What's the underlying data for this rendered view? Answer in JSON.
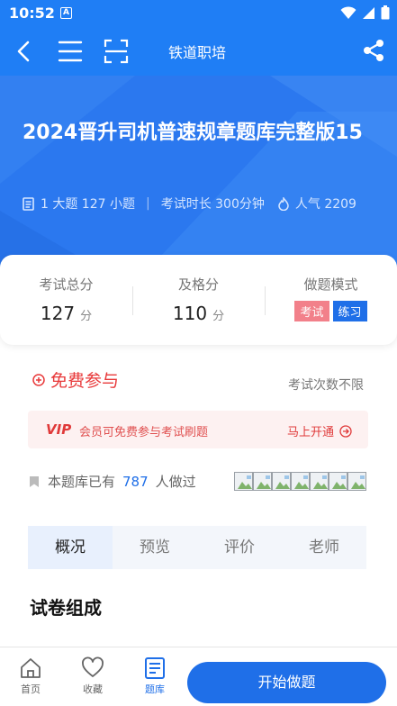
{
  "status_bar": {
    "time": "10:52",
    "a_badge": "A"
  },
  "nav": {
    "title": "铁道职培"
  },
  "hero": {
    "title": "2024晋升司机普速规章题库完整版15",
    "meta_questions": "1 大题 127 小题",
    "meta_duration": "考试时长 300分钟",
    "meta_popularity": "人气 2209"
  },
  "score_card": {
    "total_label": "考试总分",
    "total_value": "127",
    "total_unit": "分",
    "pass_label": "及格分",
    "pass_value": "110",
    "pass_unit": "分",
    "mode_label": "做题模式",
    "mode_exam": "考试",
    "mode_practice": "练习"
  },
  "free": {
    "label": "免费参与",
    "attempts": "考试次数不限"
  },
  "vip": {
    "badge": "VIP",
    "text": "会员可免费参与考试刷题",
    "cta": "马上开通"
  },
  "done": {
    "prefix": "本题库已有",
    "count": "787",
    "suffix": "人做过"
  },
  "tabs": [
    "概况",
    "预览",
    "评价",
    "老师"
  ],
  "section": {
    "title": "试卷组成"
  },
  "bottom": {
    "home": "首页",
    "favorites": "收藏",
    "question_bank": "题库",
    "start": "开始做题"
  },
  "colors": {
    "primary": "#1f6fe8",
    "red": "#e8393a",
    "tag_exam": "#f2808a"
  }
}
